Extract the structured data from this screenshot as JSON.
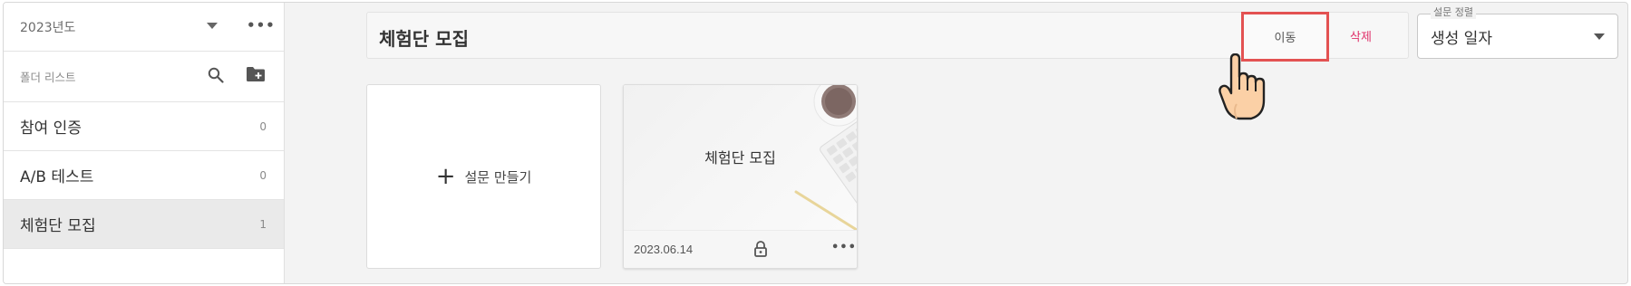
{
  "sidebar": {
    "year": "2023년도",
    "folder_header": "폴더 리스트",
    "folders": [
      {
        "name": "참여 인증",
        "count": "0"
      },
      {
        "name": "A/B 테스트",
        "count": "0"
      },
      {
        "name": "체험단 모집",
        "count": "1"
      }
    ]
  },
  "header": {
    "title": "체험단 모집",
    "move_label": "이동",
    "delete_label": "삭제"
  },
  "sort": {
    "legend": "설문 정렬",
    "value": "생성 일자"
  },
  "create_card": {
    "label": "설문 만들기",
    "plus": "+"
  },
  "survey_card": {
    "title": "체험단 모집",
    "date": "2023.06.14"
  },
  "colors": {
    "highlight_border": "#e35252",
    "delete_text": "#e0306a"
  },
  "icons": [
    "chevron-down-icon",
    "more-icon",
    "search-icon",
    "add-folder-icon",
    "plus-icon",
    "lock-icon",
    "pointing-hand-icon"
  ]
}
